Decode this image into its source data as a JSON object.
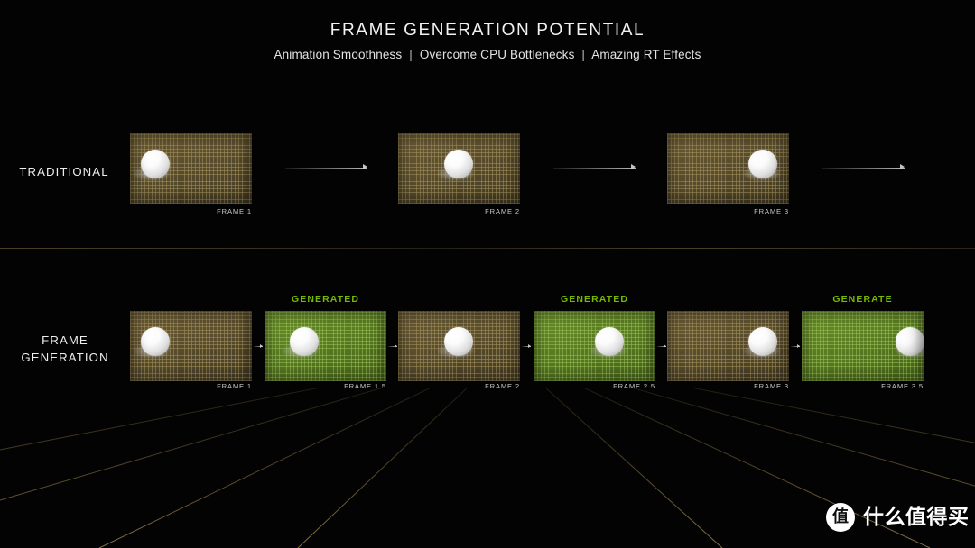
{
  "header": {
    "title": "FRAME GENERATION POTENTIAL",
    "subtitle_parts": [
      "Animation Smoothness",
      "Overcome CPU Bottlenecks",
      "Amazing RT Effects"
    ],
    "subtitle_separator": "|"
  },
  "colors": {
    "accent_green": "#76b900",
    "tile_gold": "#574b2c",
    "tile_green": "#55781f",
    "background": "#030303",
    "text_primary": "#f2f2f2",
    "caption": "#c9c9c9"
  },
  "rows": [
    {
      "label": "TRADITIONAL",
      "label_lines": [
        "TRADITIONAL"
      ],
      "frames": [
        {
          "caption": "FRAME 1",
          "kind": "rendered",
          "generated_label": null
        },
        {
          "caption": "FRAME 2",
          "kind": "rendered",
          "generated_label": null
        },
        {
          "caption": "FRAME 3",
          "kind": "rendered",
          "generated_label": null
        }
      ],
      "arrows": 3
    },
    {
      "label": "FRAME GENERATION",
      "label_lines": [
        "FRAME",
        "GENERATION"
      ],
      "frames": [
        {
          "caption": "FRAME 1",
          "kind": "rendered",
          "generated_label": null
        },
        {
          "caption": "FRAME 1.5",
          "kind": "generated",
          "generated_label": "GENERATED"
        },
        {
          "caption": "FRAME 2",
          "kind": "rendered",
          "generated_label": null
        },
        {
          "caption": "FRAME 2.5",
          "kind": "generated",
          "generated_label": "GENERATED"
        },
        {
          "caption": "FRAME 3",
          "kind": "rendered",
          "generated_label": null
        },
        {
          "caption": "FRAME 3.5",
          "kind": "generated",
          "generated_label": "GENERATE"
        }
      ],
      "arrows": 5
    }
  ],
  "watermark": {
    "badge_char": "值",
    "text": "什么值得买"
  }
}
